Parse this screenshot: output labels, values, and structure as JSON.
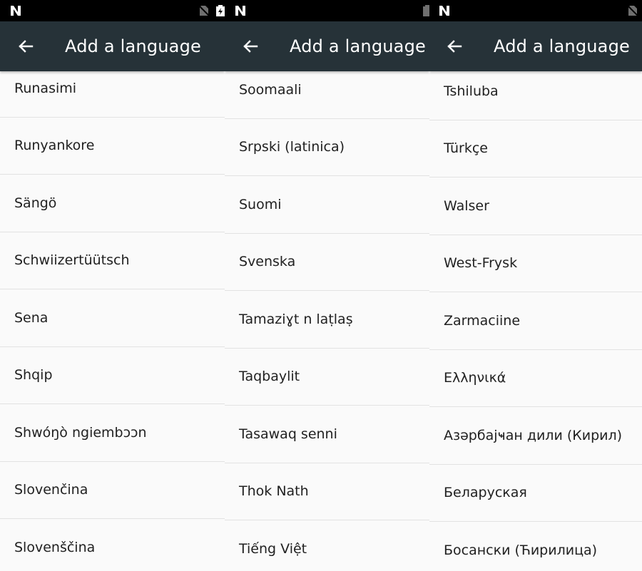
{
  "colors": {
    "statusbar": "#000000",
    "appbar": "#263238",
    "appbar_text": "#ffffff",
    "list_bg": "#fafafa",
    "divider": "#e2e2e2",
    "item_text": "#212121"
  },
  "screens": [
    {
      "status_icons": [
        "n-logo-icon",
        "no-sim-icon",
        "battery-charging-icon"
      ],
      "appbar": {
        "back_icon": "arrow-back-icon",
        "title": "Add a language"
      },
      "languages": [
        "Runasimi",
        "Runyankore",
        "Sängö",
        "Schwiizertüütsch",
        "Sena",
        "Shqip",
        "Shwóŋò ngiembɔɔn",
        "Slovenčina",
        "Slovenščina"
      ]
    },
    {
      "status_icons": [
        "n-logo-icon",
        "battery-icon"
      ],
      "appbar": {
        "back_icon": "arrow-back-icon",
        "title": "Add a language"
      },
      "languages": [
        "Soomaali",
        "Srpski (latinica)",
        "Suomi",
        "Svenska",
        "Tamaziɣt n laṭlaṣ",
        "Taqbaylit",
        "Tasawaq senni",
        "Thok Nath",
        "Tiếng Việt"
      ]
    },
    {
      "status_icons": [
        "n-logo-icon",
        "no-sim-icon"
      ],
      "appbar": {
        "back_icon": "arrow-back-icon",
        "title": "Add a language"
      },
      "languages": [
        "Tshiluba",
        "Türkçe",
        "Walser",
        "West-Frysk",
        "Zarmaciine",
        "Ελληνικά",
        "Азәрбајҹан дили (Кирил)",
        "Беларуская",
        "Босански (Ћирилица)"
      ]
    }
  ]
}
